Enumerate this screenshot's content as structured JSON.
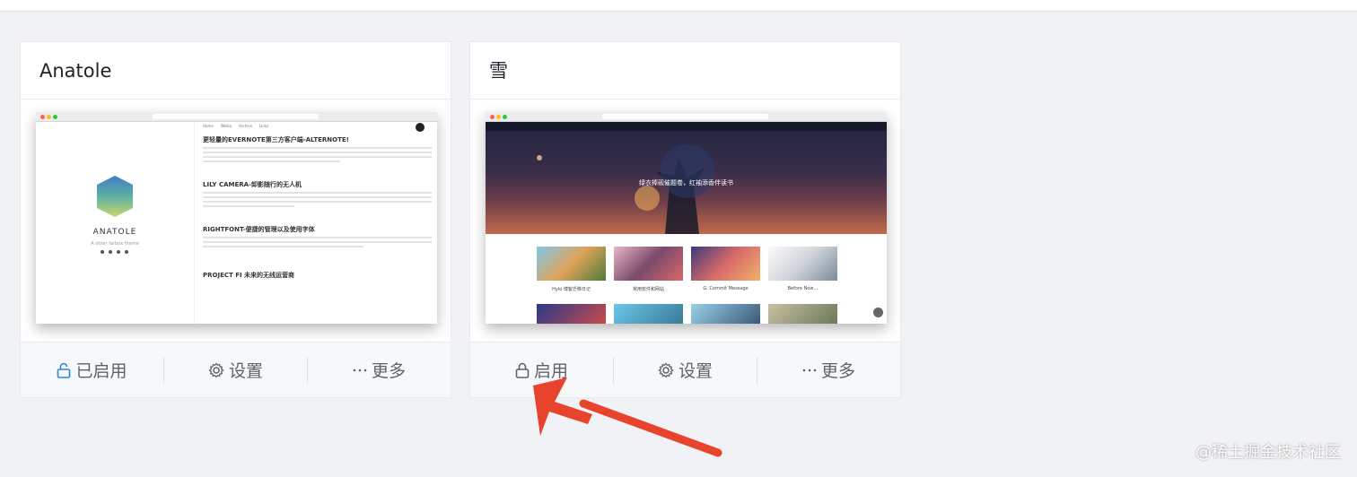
{
  "cards": [
    {
      "title": "Anatole",
      "preview": {
        "logo_text": "ANATOLE",
        "tagline": "A other farbox theme",
        "nav": [
          "Home",
          "Weibo",
          "Archive",
          "Links"
        ],
        "posts": [
          "更轻量的EVERNOTE第三方客户端-ALTERNOTE!",
          "LILY CAMERA-卸影随行的无人机",
          "RIGHTFONT-便捷的管理以及使用字体",
          "PROJECT FI 未来的无线运营商"
        ]
      },
      "actions": [
        {
          "label": "已启用",
          "icon": "unlock-icon"
        },
        {
          "label": "设置",
          "icon": "gear-icon"
        },
        {
          "label": "更多",
          "icon": "more-dots-icon"
        }
      ]
    },
    {
      "title": "雪",
      "preview": {
        "headline": "绿衣捧砚催题卷，红袖添香伴读书",
        "captions": [
          "Hylo 博客迁移日记",
          "常用软件和网站",
          "G. Commit Message",
          "Before Now…"
        ]
      },
      "actions": [
        {
          "label": "启用",
          "icon": "lock-icon"
        },
        {
          "label": "设置",
          "icon": "gear-icon"
        },
        {
          "label": "更多",
          "icon": "more-dots-icon"
        }
      ]
    }
  ],
  "colors": {
    "accent": "#2d86d9",
    "arrow": "#e8432c"
  },
  "watermark": "@稀土掘金技术社区"
}
